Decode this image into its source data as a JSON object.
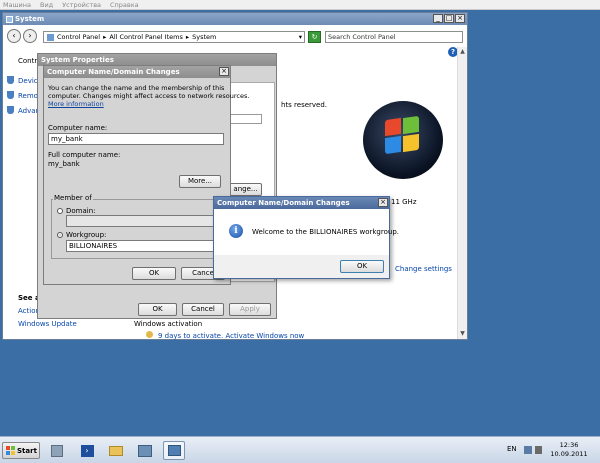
{
  "vm_menu": [
    "Машина",
    "Вид",
    "Устройства",
    "Справка"
  ],
  "system_window": {
    "title": "System",
    "breadcrumb": [
      "Control Panel",
      "All Control Panel Items",
      "System"
    ],
    "search_placeholder": "Search Control Panel",
    "left_nav": [
      "Control",
      "Device",
      "Remote",
      "Advanc"
    ],
    "see_also_label": "See al",
    "see_also_items": [
      "Action",
      "Windows Update"
    ],
    "windows_activation_label": "Windows activation",
    "activation_text": "9 days to activate. Activate Windows now",
    "rights_text": "hts reserved.",
    "computer_partial": "computer",
    "r_partial": "r",
    "ghz_partial": "11 GHz",
    "change_settings_link": "Change settings"
  },
  "system_properties": {
    "title": "System Properties",
    "ok_label": "OK",
    "cancel_label": "Cancel",
    "apply_label": "Apply",
    "change_btn_partial": "ange..."
  },
  "name_changes_dialog": {
    "title": "Computer Name/Domain Changes",
    "description": [
      "You can change the name and the membership of this",
      "computer. Changes might affect access to network resources."
    ],
    "more_info_link": "More information",
    "computer_name_label": "Computer name:",
    "computer_name_value": "my_bank",
    "full_name_label": "Full computer name:",
    "full_name_value": "my_bank",
    "more_button": "More...",
    "member_of_label": "Member of",
    "domain_label": "Domain:",
    "workgroup_label": "Workgroup:",
    "workgroup_value": "BILLIONAIRES",
    "ok_label": "OK",
    "cancel_label": "Cance"
  },
  "welcome_dialog": {
    "title": "Computer Name/Domain Changes",
    "message": "Welcome to the BILLIONAIRES workgroup.",
    "ok_label": "OK"
  },
  "taskbar": {
    "start_label": "Start",
    "language": "EN",
    "time": "12:36",
    "date": "10.09.2011"
  },
  "colors": {
    "desktop": "#3b6ea5",
    "title_active": "#4b6a9c",
    "link": "#0645ad"
  }
}
